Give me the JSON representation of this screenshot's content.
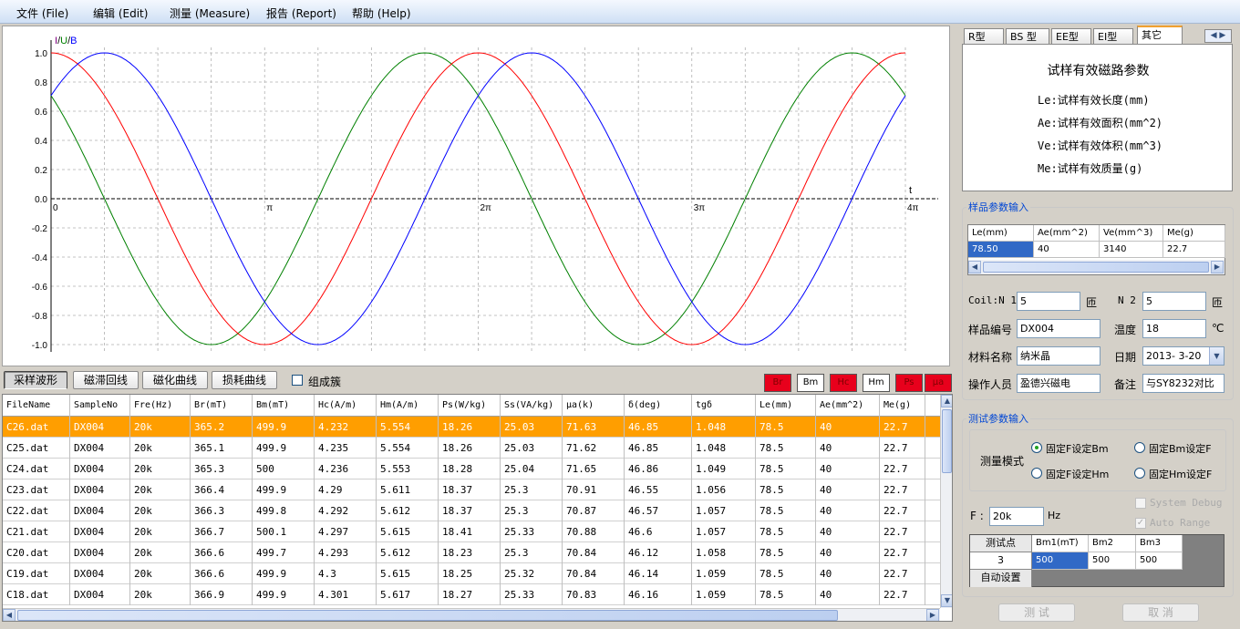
{
  "menu": [
    "文件 (File)",
    "编辑 (Edit)",
    "测量 (Measure)",
    "报告 (Report)",
    "帮助 (Help)"
  ],
  "chart_data": {
    "type": "line",
    "ylabel_parts": [
      "I",
      "/",
      "U",
      "/",
      "B"
    ],
    "xlabel": "t",
    "x_ticks": [
      "0",
      "π",
      "2π",
      "3π",
      "4π"
    ],
    "xlim": [
      0,
      4
    ],
    "x_unit": "π",
    "ylim": [
      -1.0,
      1.0
    ],
    "y_ticks": [
      "1.0",
      "0.8",
      "0.6",
      "0.4",
      "0.2",
      "0.0",
      "-0.2",
      "-0.4",
      "-0.6",
      "-0.8",
      "-1.0"
    ],
    "grid": true,
    "series": [
      {
        "color": "#008000",
        "amplitude": 1.0,
        "phase_offset_pi": 0.75
      },
      {
        "color": "#ff0000",
        "amplitude": 1.0,
        "phase_offset_pi": 0.5
      },
      {
        "color": "#0000ff",
        "amplitude": 1.0,
        "phase_offset_pi": 0.25
      }
    ]
  },
  "view_tabs": [
    {
      "label": "采样波形",
      "active": true
    },
    {
      "label": "磁滞回线",
      "active": false
    },
    {
      "label": "磁化曲线",
      "active": false
    },
    {
      "label": "损耗曲线",
      "active": false
    }
  ],
  "group_checkbox": {
    "label": "组成簇",
    "checked": false
  },
  "switches": [
    {
      "label": "Br",
      "on": true
    },
    {
      "label": "Bm",
      "on": false
    },
    {
      "label": "Hc",
      "on": true
    },
    {
      "label": "Hm",
      "on": false
    },
    {
      "label": "Ps",
      "on": true
    },
    {
      "label": "μa",
      "on": true
    }
  ],
  "table": {
    "columns": [
      "FileName",
      "SampleNo",
      "Fre(Hz)",
      "Br(mT)",
      "Bm(mT)",
      "Hc(A/m)",
      "Hm(A/m)",
      "Ps(W/kg)",
      "Ss(VA/kg)",
      "μa(k)",
      "δ(deg)",
      "tgδ",
      "Le(mm)",
      "Ae(mm^2)",
      "Me(g)"
    ],
    "rows": [
      [
        "C26.dat",
        "DX004",
        "20k",
        "365.2",
        "499.9",
        "4.232",
        "5.554",
        "18.26",
        "25.03",
        "71.63",
        "46.85",
        "1.048",
        "78.5",
        "40",
        "22.7"
      ],
      [
        "C25.dat",
        "DX004",
        "20k",
        "365.1",
        "499.9",
        "4.235",
        "5.554",
        "18.26",
        "25.03",
        "71.62",
        "46.85",
        "1.048",
        "78.5",
        "40",
        "22.7"
      ],
      [
        "C24.dat",
        "DX004",
        "20k",
        "365.3",
        "500",
        "4.236",
        "5.553",
        "18.28",
        "25.04",
        "71.65",
        "46.86",
        "1.049",
        "78.5",
        "40",
        "22.7"
      ],
      [
        "C23.dat",
        "DX004",
        "20k",
        "366.4",
        "499.9",
        "4.29",
        "5.611",
        "18.37",
        "25.3",
        "70.91",
        "46.55",
        "1.056",
        "78.5",
        "40",
        "22.7"
      ],
      [
        "C22.dat",
        "DX004",
        "20k",
        "366.3",
        "499.8",
        "4.292",
        "5.612",
        "18.37",
        "25.3",
        "70.87",
        "46.57",
        "1.057",
        "78.5",
        "40",
        "22.7"
      ],
      [
        "C21.dat",
        "DX004",
        "20k",
        "366.7",
        "500.1",
        "4.297",
        "5.615",
        "18.41",
        "25.33",
        "70.88",
        "46.6",
        "1.057",
        "78.5",
        "40",
        "22.7"
      ],
      [
        "C20.dat",
        "DX004",
        "20k",
        "366.6",
        "499.7",
        "4.293",
        "5.612",
        "18.23",
        "25.3",
        "70.84",
        "46.12",
        "1.058",
        "78.5",
        "40",
        "22.7"
      ],
      [
        "C19.dat",
        "DX004",
        "20k",
        "366.6",
        "499.9",
        "4.3",
        "5.615",
        "18.25",
        "25.32",
        "70.84",
        "46.14",
        "1.059",
        "78.5",
        "40",
        "22.7"
      ],
      [
        "C18.dat",
        "DX004",
        "20k",
        "366.9",
        "499.9",
        "4.301",
        "5.617",
        "18.27",
        "25.33",
        "70.83",
        "46.16",
        "1.059",
        "78.5",
        "40",
        "22.7"
      ]
    ],
    "selected_row": 0
  },
  "right_tabs": [
    {
      "label": "R型",
      "active": false
    },
    {
      "label": "BS 型",
      "active": false
    },
    {
      "label": "EE型",
      "active": false
    },
    {
      "label": "EI型",
      "active": false
    },
    {
      "label": "其它",
      "active": true
    }
  ],
  "info": {
    "title": "试样有效磁路参数",
    "lines": [
      "Le:试样有效长度(mm)",
      "Ae:试样有效面积(mm^2)",
      "Ve:试样有效体积(mm^3)",
      "Me:试样有效质量(g)"
    ]
  },
  "sample": {
    "group_label": "样品参数输入",
    "grid_headers": [
      "Le(mm)",
      "Ae(mm^2)",
      "Ve(mm^3)",
      "Me(g)"
    ],
    "grid_values": [
      "78.50",
      "40",
      "3140",
      "22.7"
    ],
    "coil_n1_label": "Coil:N 1",
    "coil_n1": "5",
    "n2_label": "N 2",
    "n2": "5",
    "turns_unit": "匝",
    "sample_no_label": "样品编号",
    "sample_no": "DX004",
    "temp_label": "温度",
    "temp": "18",
    "temp_unit": "℃",
    "material_label": "材料名称",
    "material": "纳米晶",
    "date_label": "日期",
    "date": "2013- 3-20",
    "operator_label": "操作人员",
    "operator": "盈德兴磁电",
    "note_label": "备注",
    "note": "与SY8232对比"
  },
  "test": {
    "group_label": "测试参数输入",
    "mode_label": "测量模式",
    "modes": [
      {
        "label": "固定F设定Bm",
        "on": true
      },
      {
        "label": "固定Bm设定F",
        "on": false
      },
      {
        "label": "固定F设定Hm",
        "on": false
      },
      {
        "label": "固定Hm设定F",
        "on": false
      }
    ],
    "system_debug": "System Debug",
    "auto_range": "Auto Range",
    "f_label": "F :",
    "f_value": "20k",
    "f_unit": "Hz",
    "points_label": "测试点",
    "points_value": "3",
    "auto_set": "自动设置",
    "bm_headers": [
      "Bm1(mT)",
      "Bm2",
      "Bm3"
    ],
    "bm_values": [
      "500",
      "500",
      "500"
    ],
    "test_button": "测 试",
    "cancel_button": "取 消"
  }
}
